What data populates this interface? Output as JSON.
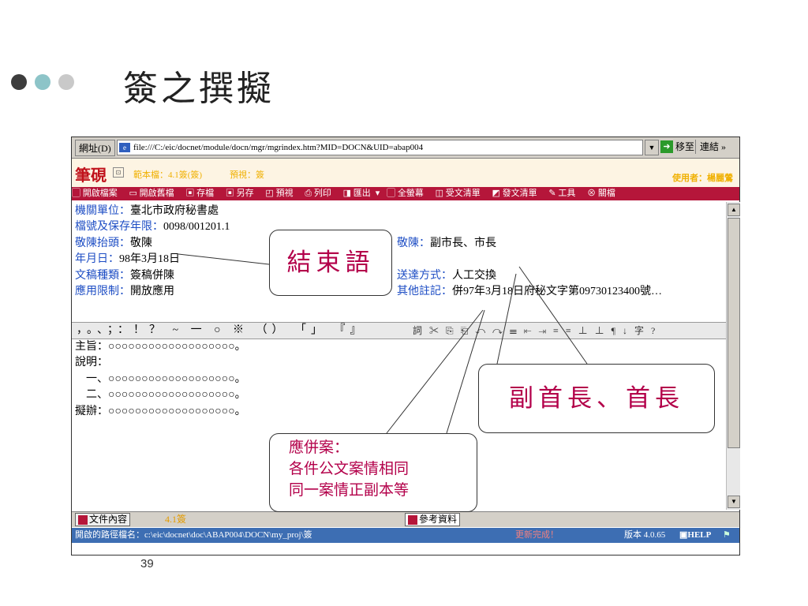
{
  "slide": {
    "title": "簽之撰擬",
    "page_number": "39",
    "dot_colors": [
      "#3d3d3d",
      "#8dc4c8",
      "#c9c9c9"
    ]
  },
  "browser": {
    "address_label": "網址(D)",
    "url": "file:///C:/eic/docnet/module/docn/mgr/mgrindex.htm?MID=DOCN&UID=abap004",
    "go_label": "移至",
    "links_label": "連結 »"
  },
  "app": {
    "brand": "筆硯",
    "version": "範本檔：4.1簽(簽)",
    "preview": "預視：簽",
    "user": "使用者：楊麗鶯",
    "menu": [
      "開啟檔案",
      "開啟舊檔",
      "存檔",
      "另存",
      "預視",
      "列印",
      "匯出",
      "全螢幕",
      "受文清單",
      "發文清單",
      "工具",
      "關檔"
    ]
  },
  "fields": {
    "agency_label": "機關單位：",
    "agency_value": "臺北市政府秘書處",
    "file_no_label": "檔號及保存年限：",
    "file_no_value": "0098/001201.1",
    "top_label": "敬陳抬頭：",
    "top_value": "敬陳",
    "date_label": "年月日：",
    "date_value": "98年3月18日",
    "doc_type_label": "文稿種類：",
    "doc_type_value": "簽稿併陳",
    "use_label": "應用限制：",
    "use_value": "開放應用",
    "respect_label": "敬陳：",
    "respect_value": "副市長、市長",
    "delivery_label": "送達方式：",
    "delivery_value": "人工交換",
    "note_label": "其他註記：",
    "note_value": "併97年3月18日府秘文字第09730123400號…"
  },
  "punct_toolbar": "，。、；：！？ ~ 一 ○ ※ （） 「」 『』",
  "edit_toolbar": "詞 ✂ ⎘ ⎗ ↶ ↷ ☰ ⇤ ⇥ ≡ ≡ ⊥ ⊥ ¶ ↓ 字 ?",
  "body": {
    "subject": "主旨：○○○○○○○○○○○○○○○○○○○。",
    "desc": "說明：",
    "item1": "　一、○○○○○○○○○○○○○○○○○○○。",
    "item2": "　二、○○○○○○○○○○○○○○○○○○○。",
    "proposal": "擬辦：○○○○○○○○○○○○○○○○○○○。"
  },
  "status": {
    "tab_label": "文件內容",
    "count": "4.1簽",
    "ref_label": "參考資料",
    "path": "開啟的路徑檔名：c:\\eic\\docnet\\doc\\ABAP004\\DOCN\\my_proj\\簽",
    "done": "更新完成！",
    "version": "版本 4.0.65",
    "help": "HELP"
  },
  "callouts": {
    "ending": "結束語",
    "heads": "副首長、首長",
    "merge_title": "應併案：",
    "merge_line1": "各件公文案情相同",
    "merge_line2": "同一案情正副本等"
  }
}
